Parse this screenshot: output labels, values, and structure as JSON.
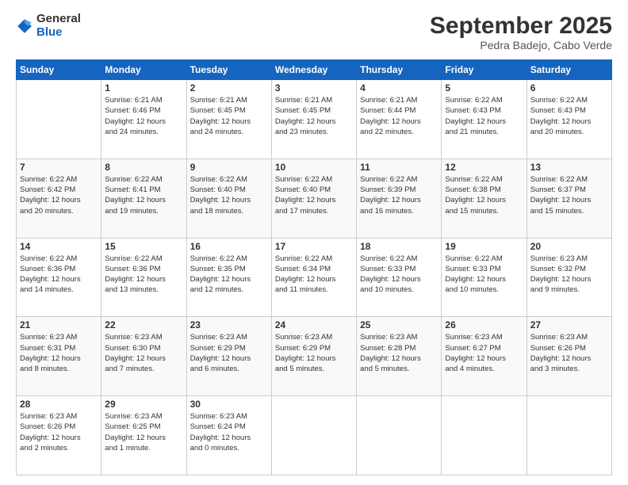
{
  "logo": {
    "general": "General",
    "blue": "Blue"
  },
  "title": "September 2025",
  "subtitle": "Pedra Badejo, Cabo Verde",
  "days_header": [
    "Sunday",
    "Monday",
    "Tuesday",
    "Wednesday",
    "Thursday",
    "Friday",
    "Saturday"
  ],
  "weeks": [
    [
      {
        "num": "",
        "info": ""
      },
      {
        "num": "1",
        "info": "Sunrise: 6:21 AM\nSunset: 6:46 PM\nDaylight: 12 hours\nand 24 minutes."
      },
      {
        "num": "2",
        "info": "Sunrise: 6:21 AM\nSunset: 6:45 PM\nDaylight: 12 hours\nand 24 minutes."
      },
      {
        "num": "3",
        "info": "Sunrise: 6:21 AM\nSunset: 6:45 PM\nDaylight: 12 hours\nand 23 minutes."
      },
      {
        "num": "4",
        "info": "Sunrise: 6:21 AM\nSunset: 6:44 PM\nDaylight: 12 hours\nand 22 minutes."
      },
      {
        "num": "5",
        "info": "Sunrise: 6:22 AM\nSunset: 6:43 PM\nDaylight: 12 hours\nand 21 minutes."
      },
      {
        "num": "6",
        "info": "Sunrise: 6:22 AM\nSunset: 6:43 PM\nDaylight: 12 hours\nand 20 minutes."
      }
    ],
    [
      {
        "num": "7",
        "info": "Sunrise: 6:22 AM\nSunset: 6:42 PM\nDaylight: 12 hours\nand 20 minutes."
      },
      {
        "num": "8",
        "info": "Sunrise: 6:22 AM\nSunset: 6:41 PM\nDaylight: 12 hours\nand 19 minutes."
      },
      {
        "num": "9",
        "info": "Sunrise: 6:22 AM\nSunset: 6:40 PM\nDaylight: 12 hours\nand 18 minutes."
      },
      {
        "num": "10",
        "info": "Sunrise: 6:22 AM\nSunset: 6:40 PM\nDaylight: 12 hours\nand 17 minutes."
      },
      {
        "num": "11",
        "info": "Sunrise: 6:22 AM\nSunset: 6:39 PM\nDaylight: 12 hours\nand 16 minutes."
      },
      {
        "num": "12",
        "info": "Sunrise: 6:22 AM\nSunset: 6:38 PM\nDaylight: 12 hours\nand 15 minutes."
      },
      {
        "num": "13",
        "info": "Sunrise: 6:22 AM\nSunset: 6:37 PM\nDaylight: 12 hours\nand 15 minutes."
      }
    ],
    [
      {
        "num": "14",
        "info": "Sunrise: 6:22 AM\nSunset: 6:36 PM\nDaylight: 12 hours\nand 14 minutes."
      },
      {
        "num": "15",
        "info": "Sunrise: 6:22 AM\nSunset: 6:36 PM\nDaylight: 12 hours\nand 13 minutes."
      },
      {
        "num": "16",
        "info": "Sunrise: 6:22 AM\nSunset: 6:35 PM\nDaylight: 12 hours\nand 12 minutes."
      },
      {
        "num": "17",
        "info": "Sunrise: 6:22 AM\nSunset: 6:34 PM\nDaylight: 12 hours\nand 11 minutes."
      },
      {
        "num": "18",
        "info": "Sunrise: 6:22 AM\nSunset: 6:33 PM\nDaylight: 12 hours\nand 10 minutes."
      },
      {
        "num": "19",
        "info": "Sunrise: 6:22 AM\nSunset: 6:33 PM\nDaylight: 12 hours\nand 10 minutes."
      },
      {
        "num": "20",
        "info": "Sunrise: 6:23 AM\nSunset: 6:32 PM\nDaylight: 12 hours\nand 9 minutes."
      }
    ],
    [
      {
        "num": "21",
        "info": "Sunrise: 6:23 AM\nSunset: 6:31 PM\nDaylight: 12 hours\nand 8 minutes."
      },
      {
        "num": "22",
        "info": "Sunrise: 6:23 AM\nSunset: 6:30 PM\nDaylight: 12 hours\nand 7 minutes."
      },
      {
        "num": "23",
        "info": "Sunrise: 6:23 AM\nSunset: 6:29 PM\nDaylight: 12 hours\nand 6 minutes."
      },
      {
        "num": "24",
        "info": "Sunrise: 6:23 AM\nSunset: 6:29 PM\nDaylight: 12 hours\nand 5 minutes."
      },
      {
        "num": "25",
        "info": "Sunrise: 6:23 AM\nSunset: 6:28 PM\nDaylight: 12 hours\nand 5 minutes."
      },
      {
        "num": "26",
        "info": "Sunrise: 6:23 AM\nSunset: 6:27 PM\nDaylight: 12 hours\nand 4 minutes."
      },
      {
        "num": "27",
        "info": "Sunrise: 6:23 AM\nSunset: 6:26 PM\nDaylight: 12 hours\nand 3 minutes."
      }
    ],
    [
      {
        "num": "28",
        "info": "Sunrise: 6:23 AM\nSunset: 6:26 PM\nDaylight: 12 hours\nand 2 minutes."
      },
      {
        "num": "29",
        "info": "Sunrise: 6:23 AM\nSunset: 6:25 PM\nDaylight: 12 hours\nand 1 minute."
      },
      {
        "num": "30",
        "info": "Sunrise: 6:23 AM\nSunset: 6:24 PM\nDaylight: 12 hours\nand 0 minutes."
      },
      {
        "num": "",
        "info": ""
      },
      {
        "num": "",
        "info": ""
      },
      {
        "num": "",
        "info": ""
      },
      {
        "num": "",
        "info": ""
      }
    ]
  ]
}
